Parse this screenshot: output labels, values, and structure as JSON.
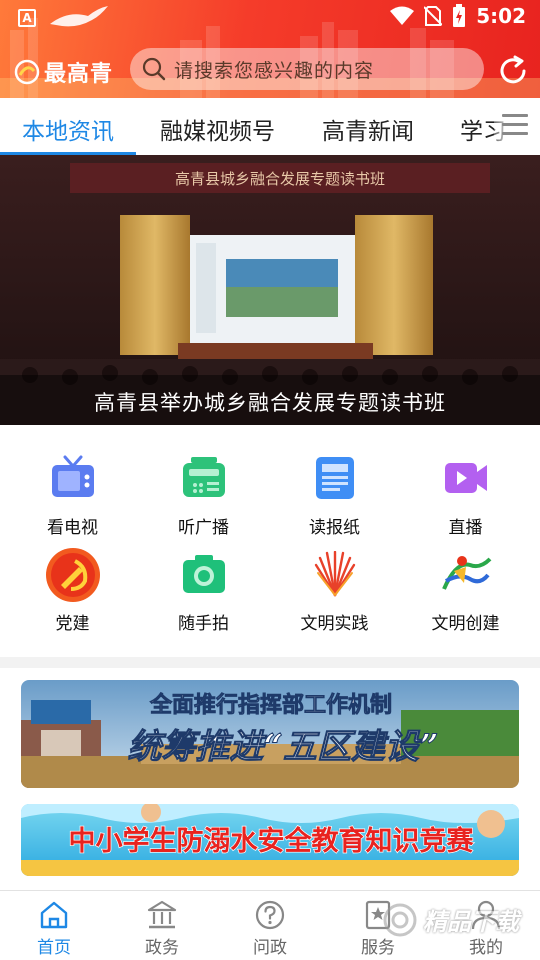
{
  "status_bar": {
    "time": "5:02",
    "left_glyph": "A"
  },
  "header": {
    "logo_text": "最高青",
    "search_placeholder": "请搜索您感兴趣的内容"
  },
  "tabs": [
    {
      "label": "本地资讯",
      "active": true
    },
    {
      "label": "融媒视频号",
      "active": false
    },
    {
      "label": "高青新闻",
      "active": false
    },
    {
      "label": "学习",
      "active": false
    }
  ],
  "banner": {
    "caption": "高青县举办城乡融合发展专题读书班",
    "stage_sign": "高青县城乡融合发展专题读书班"
  },
  "quick_links": [
    {
      "label": "看电视",
      "icon": "tv-icon"
    },
    {
      "label": "听广播",
      "icon": "radio-icon"
    },
    {
      "label": "读报纸",
      "icon": "newspaper-icon"
    },
    {
      "label": "直播",
      "icon": "live-video-icon"
    },
    {
      "label": "党建",
      "icon": "party-emblem-icon"
    },
    {
      "label": "随手拍",
      "icon": "camera-icon"
    },
    {
      "label": "文明实践",
      "icon": "civilization-practice-icon"
    },
    {
      "label": "文明创建",
      "icon": "civilization-creation-icon"
    }
  ],
  "promos": [
    {
      "line1": "全面推行指挥部工作机制",
      "line2": "统筹推进“五区建设”"
    },
    {
      "line1": "中小学生防溺水安全教育知识竞赛"
    }
  ],
  "bottom_nav": [
    {
      "label": "首页",
      "icon": "home-icon",
      "active": true
    },
    {
      "label": "政务",
      "icon": "government-icon",
      "active": false
    },
    {
      "label": "问政",
      "icon": "question-icon",
      "active": false
    },
    {
      "label": "服务",
      "icon": "service-icon",
      "active": false
    },
    {
      "label": "我的",
      "icon": "user-icon",
      "active": false
    }
  ],
  "watermark": {
    "text": "精品下载"
  },
  "colors": {
    "accent": "#1e88e5",
    "header_start": "#ff7a3a",
    "header_end": "#e8231f"
  }
}
